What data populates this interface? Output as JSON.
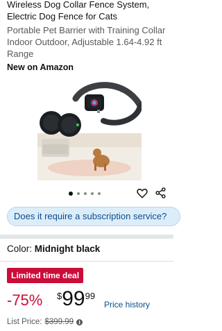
{
  "product": {
    "title": "Wireless Dog Collar Fence System, Electric Dog Fence for Cats",
    "subtitle": "Portable Pet Barrier with Training Collar Indoor Outdoor, Adjustable 1.64-4.92 ft Range",
    "badge": "New on Amazon"
  },
  "gallery": {
    "image_icon": "product-photo-collar-and-transmitters",
    "image_count": 5,
    "active_index": 0
  },
  "actions": {
    "wishlist_icon": "heart-icon",
    "share_icon": "share-icon"
  },
  "question": {
    "text": "Does it require a subscription service?"
  },
  "variant": {
    "label": "Color:",
    "value": "Midnight black"
  },
  "deal": {
    "badge": "Limited time deal",
    "discount": "-75%",
    "currency": "$",
    "price_whole": "99",
    "price_fraction": "99",
    "price_history_link": "Price history",
    "list_price_label": "List Price:",
    "list_price_value": "$399.99",
    "info_icon": "info-icon"
  },
  "colors": {
    "deal_red": "#cc0c39",
    "link_blue": "#0c4c8a",
    "pill_bg": "#dcedfa"
  }
}
